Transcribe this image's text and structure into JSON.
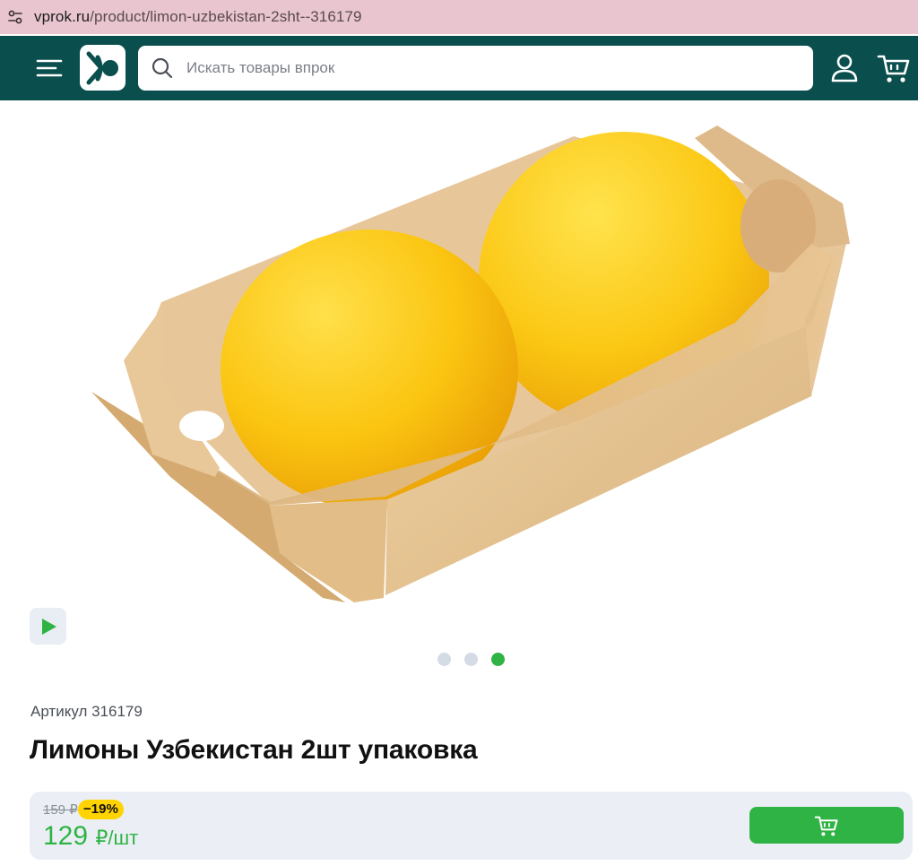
{
  "browser": {
    "url_host": "vprok.ru",
    "url_path": "/product/limon-uzbekistan-2sht--316179",
    "site_info_icon": "tune-icon"
  },
  "header": {
    "menu_icon": "hamburger-menu-icon",
    "logo_icon": "vprok-logo-icon",
    "search_placeholder": "Искать товары впрок",
    "search_icon": "search-icon",
    "user_icon": "user-icon",
    "cart_icon": "cart-icon",
    "background": "#0b4e4e"
  },
  "gallery": {
    "image_description_icon": "lemons-product-image",
    "play_icon": "play-icon",
    "slides_total": 3,
    "active_slide": 3
  },
  "product": {
    "sku_label": "Артикул 316179",
    "title": "Лимоны Узбекистан 2шт упаковка"
  },
  "pricing": {
    "old_price": "159 ₽",
    "discount": "−19%",
    "new_price": "129",
    "unit": "₽/шт",
    "accent_color": "#2fb344",
    "discount_color": "#ffd400",
    "add_to_cart_icon": "cart-icon"
  }
}
